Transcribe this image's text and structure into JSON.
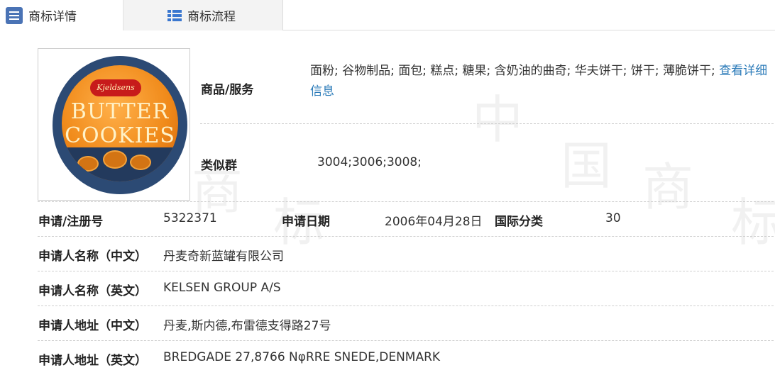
{
  "tabs": {
    "detail": {
      "label": "商标详情",
      "icon": "list-icon"
    },
    "flow": {
      "label": "商标流程",
      "icon": "table-list-icon"
    }
  },
  "watermark": [
    "中",
    "国",
    "商",
    "标",
    "商",
    "标"
  ],
  "logo": {
    "badge_text": "Kjeldsens",
    "line1": "BUTTER",
    "line2": "COOKIES",
    "colors": {
      "tin": "#2c4a74",
      "face": "#f08a1a",
      "badge": "#c71b1b"
    }
  },
  "goods": {
    "label": "商品/服务",
    "text": "面粉; 谷物制品; 面包; 糕点; 糖果; 含奶油的曲奇; 华夫饼干; 饼干; 薄脆饼干;",
    "link": "查看详细信息"
  },
  "similar_group": {
    "label": "类似群",
    "value": "3004;3006;3008;"
  },
  "registration": {
    "number_label": "申请/注册号",
    "number": "5322371",
    "date_label": "申请日期",
    "date": "2006年04月28日",
    "class_label": "国际分类",
    "class": "30"
  },
  "applicant_cn": {
    "label": "申请人名称（中文）",
    "value": "丹麦奇新蓝罐有限公司"
  },
  "applicant_en": {
    "label": "申请人名称（英文）",
    "value": "KELSEN GROUP A/S"
  },
  "address_cn": {
    "label": "申请人地址（中文）",
    "value": "丹麦,斯内德,布雷德支得路27号"
  },
  "address_en": {
    "label": "申请人地址（英文）",
    "value": "BREDGADE 27,8766 NφRRE SNEDE,DENMARK"
  },
  "link_color": "#2a7ab8"
}
